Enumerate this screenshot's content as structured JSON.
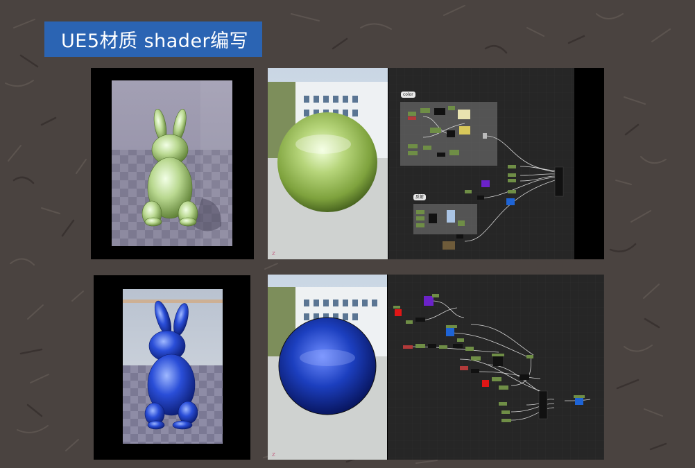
{
  "title": "UE5材质 shader编写",
  "rows": [
    {
      "name": "green-chrome",
      "sphere_tint": "#9fc35a",
      "bunny_tint": "#b9d890",
      "graph_comments": [
        "color",
        "反射"
      ]
    },
    {
      "name": "blue-chrome",
      "sphere_tint": "#1c3fbf",
      "bunny_tint": "#2a4ed8",
      "graph_comments": []
    }
  ],
  "viewport_axis_label": "Z",
  "colors": {
    "banner": "#2b64b3",
    "background": "#4a4340",
    "graph_bg": "#252525",
    "node_green": "#6f8e46",
    "node_red": "#e01616",
    "node_purple": "#6b22c9",
    "node_blue": "#1e64d6"
  }
}
